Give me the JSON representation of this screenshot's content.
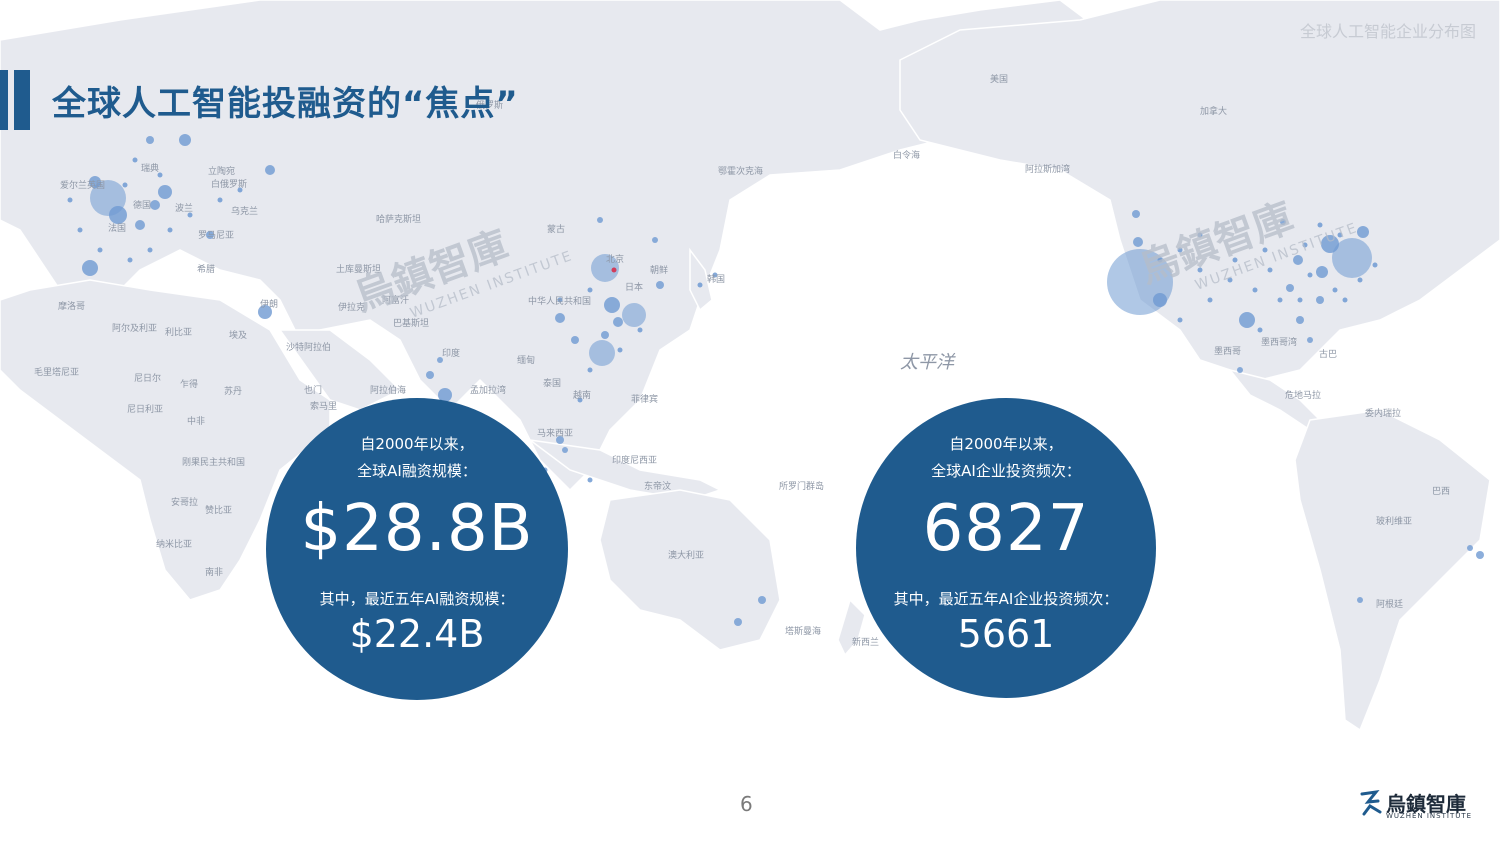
{
  "header": {
    "top_right_caption": "全球人工智能企业分布图",
    "title": "全球人工智能投融资的“焦点”"
  },
  "colors": {
    "brand_blue": "#1f5b8e",
    "land": "#e7e9ef",
    "dot": "#6f9ad2"
  },
  "map": {
    "ocean_label": "太平洋",
    "labels": [
      "俄罗斯",
      "美国",
      "加拿大",
      "白令海",
      "阿拉斯加湾",
      "鄂霍次克海",
      "蒙古",
      "中华人民共和国",
      "北京",
      "朝鲜",
      "韩国",
      "日本",
      "哈萨克斯坦",
      "土库曼斯坦",
      "阿富汗",
      "巴基斯坦",
      "伊拉克",
      "伊朗",
      "沙特阿拉伯",
      "印度",
      "阿拉伯海",
      "孟加拉湾",
      "泰国",
      "缅甸",
      "越南",
      "菲律宾",
      "马来西亚",
      "印度尼西亚",
      "东帝汶",
      "所罗门群岛",
      "澳大利亚",
      "塔斯曼海",
      "新西兰",
      "埃及",
      "利比亚",
      "阿尔及利亚",
      "摩洛哥",
      "毛里塔尼亚",
      "尼日尔",
      "乍得",
      "苏丹",
      "尼日利亚",
      "中非",
      "也门",
      "索马里",
      "刚果民主共和国",
      "安哥拉",
      "赞比亚",
      "纳米比亚",
      "南非",
      "立陶宛",
      "白俄罗斯",
      "乌克兰",
      "罗马尼亚",
      "波兰",
      "德国",
      "法国",
      "英国",
      "希腊",
      "墨西哥",
      "古巴",
      "墨西哥湾",
      "危地马拉",
      "委内瑞拉",
      "巴西",
      "玻利维亚",
      "阿根廷",
      "爱尔兰",
      "瑞典"
    ],
    "cities": [
      "北京"
    ]
  },
  "circles": {
    "left": {
      "line1": "自2000年以来，",
      "line2": "全球AI融资规模：",
      "big_value": "$28.8B",
      "line3": "其中，最近五年AI融资规模：",
      "small_value": "$22.4B"
    },
    "right": {
      "line1": "自2000年以来，",
      "line2": "全球AI企业投资频次：",
      "big_value": "6827",
      "line3": "其中，最近五年AI企业投资频次：",
      "small_value": "5661"
    }
  },
  "watermark": {
    "cn": "烏鎮智庫",
    "en": "WUZHEN INSTITUTE"
  },
  "footer": {
    "page_number": "6",
    "logo_cn": "烏鎮智庫",
    "logo_en": "WUZHEN  INSTITUTE"
  }
}
